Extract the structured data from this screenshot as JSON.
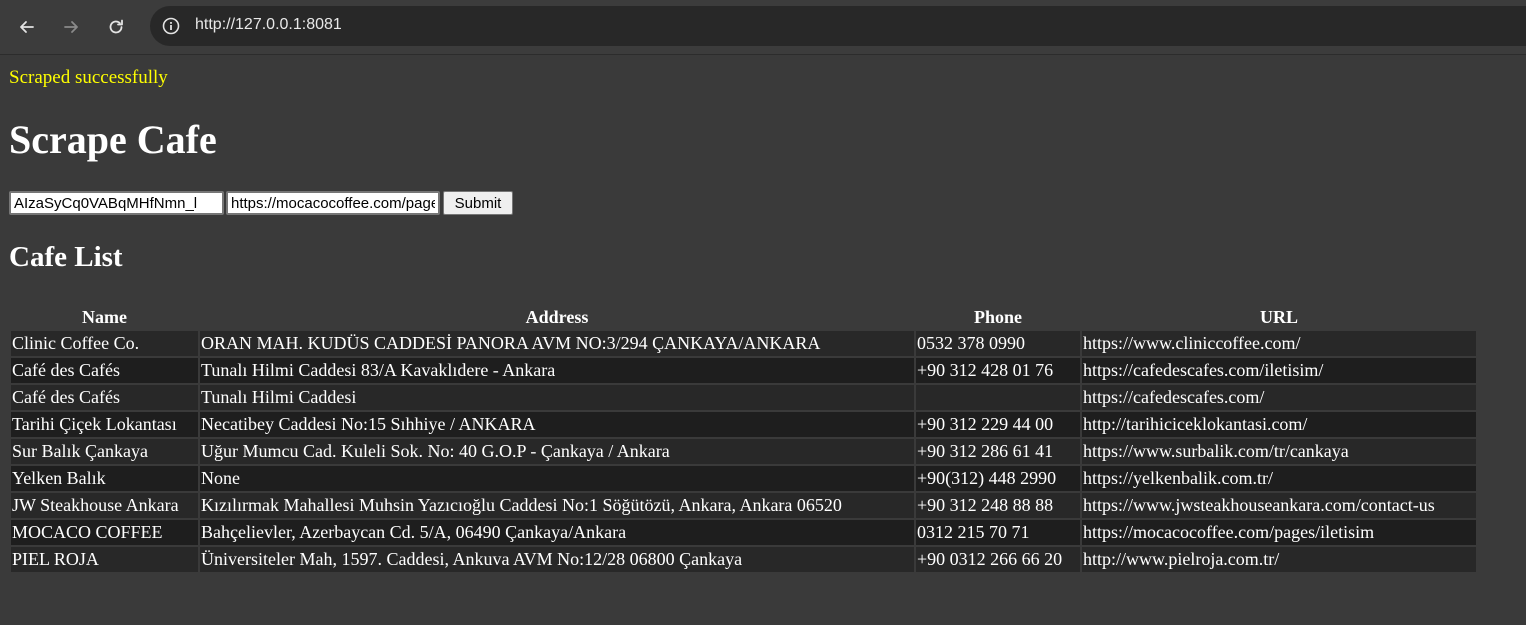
{
  "browser": {
    "url": "http://127.0.0.1:8081",
    "back_icon": "arrow-left-icon",
    "forward_icon": "arrow-right-icon",
    "reload_icon": "reload-icon",
    "site_info_icon": "info-icon"
  },
  "flash_message": "Scraped successfully",
  "page_title": "Scrape Cafe",
  "form": {
    "api_key_value": "AIzaSyCq0VABqMHfNmn_l",
    "url_value": "https://mocacocoffee.com/pages/iletisim",
    "submit_label": "Submit"
  },
  "section_title": "Cafe List",
  "table": {
    "headers": [
      "Name",
      "Address",
      "Phone",
      "URL"
    ],
    "rows": [
      [
        "Clinic Coffee Co.",
        "ORAN MAH. KUDÜS CADDESİ PANORA AVM NO:3/294 ÇANKAYA/ANKARA",
        "0532 378 0990",
        "https://www.cliniccoffee.com/"
      ],
      [
        "Café des Cafés",
        "Tunalı Hilmi Caddesi 83/A Kavaklıdere - Ankara",
        "+90 312 428 01 76",
        "https://cafedescafes.com/iletisim/"
      ],
      [
        "Café des Cafés",
        "Tunalı Hilmi Caddesi",
        "",
        "https://cafedescafes.com/"
      ],
      [
        "Tarihi Çiçek Lokantası",
        "Necatibey Caddesi No:15 Sıhhiye / ANKARA",
        "+90 312 229 44 00",
        "http://tarihiciceklokantasi.com/"
      ],
      [
        "Sur Balık Çankaya",
        "Uğur Mumcu Cad. Kuleli Sok. No: 40 G.O.P - Çankaya / Ankara",
        "+90 312 286 61 41",
        "https://www.surbalik.com/tr/cankaya"
      ],
      [
        "Yelken Balık",
        "None",
        "+90(312) 448 2990",
        "https://yelkenbalik.com.tr/"
      ],
      [
        "JW Steakhouse Ankara",
        "Kızılırmak Mahallesi Muhsin Yazıcıoğlu Caddesi No:1 Söğütözü, Ankara, Ankara 06520",
        "+90 312 248 88 88",
        "https://www.jwsteakhouseankara.com/contact-us"
      ],
      [
        "MOCACO COFFEE",
        "Bahçelievler, Azerbaycan Cd. 5/A, 06490 Çankaya/Ankara",
        "0312 215 70 71",
        "https://mocacocoffee.com/pages/iletisim"
      ],
      [
        "PIEL ROJA",
        "Üniversiteler Mah, 1597. Caddesi, Ankuva AVM No:12/28 06800 Çankaya",
        "+90 0312 266 66 20",
        "http://www.pielroja.com.tr/"
      ]
    ]
  }
}
